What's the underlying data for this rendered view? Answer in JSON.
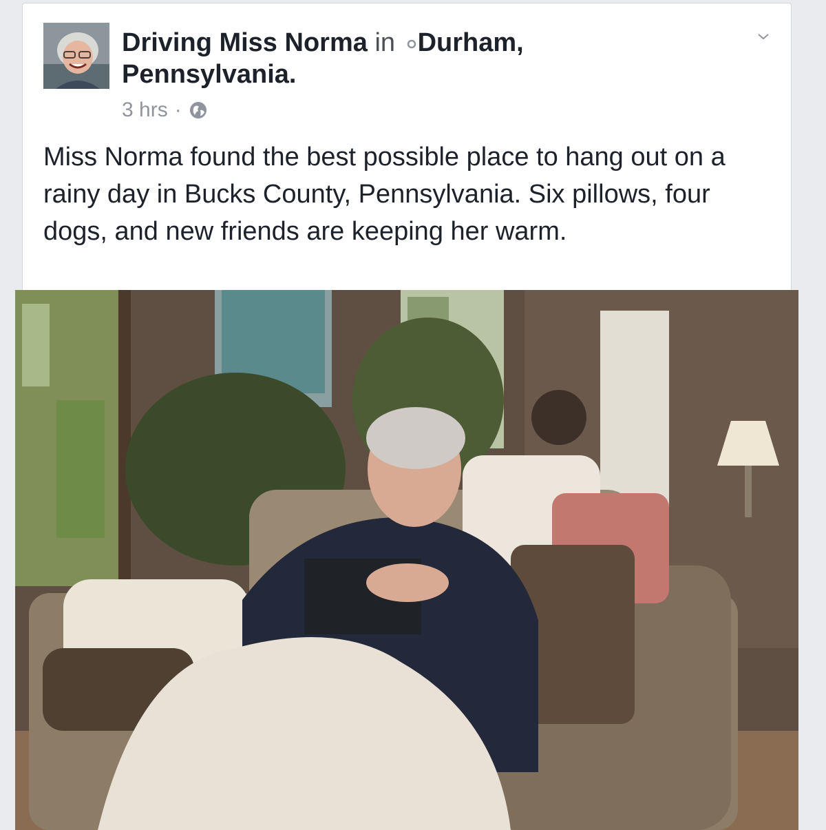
{
  "post": {
    "author": "Driving Miss Norma",
    "in_word": "in",
    "location": "Durham, Pennsylvania.",
    "time": "3 hrs",
    "separator": "·",
    "privacy_icon": "globe-icon",
    "body": "Miss Norma found the best possible place to hang out on a rainy day in Bucks County, Pennsylvania. Six pillows, four dogs, and new friends are keeping her warm.",
    "menu_icon": "chevron-down-icon"
  },
  "colors": {
    "text": "#1d2129",
    "meta": "#90949c",
    "background": "#e9ebee"
  }
}
